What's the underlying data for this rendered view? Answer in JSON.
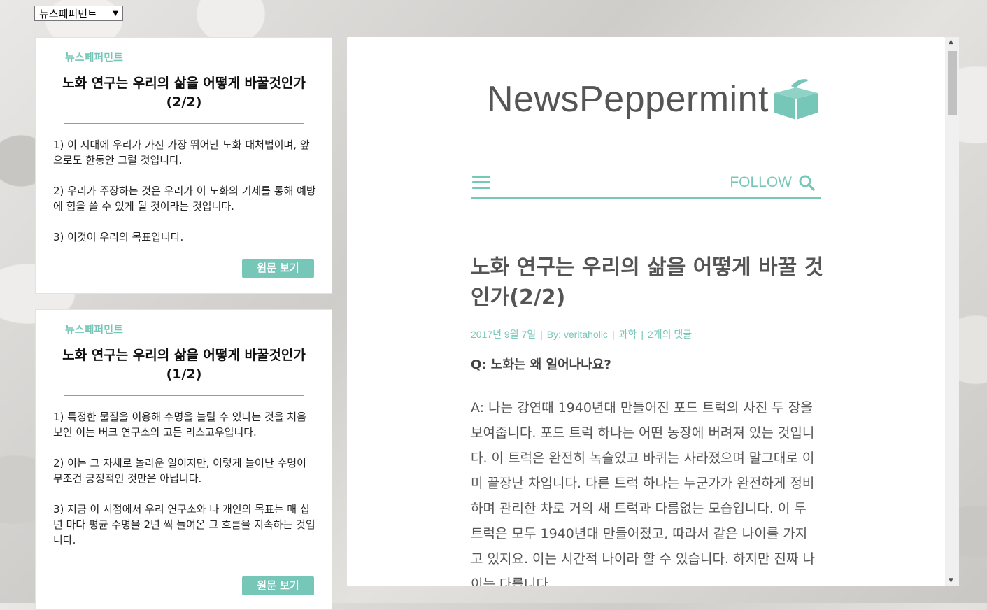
{
  "site_select": {
    "value": "뉴스페퍼민트"
  },
  "sidebar": {
    "cards": [
      {
        "source": "뉴스페퍼민트",
        "title": "노화 연구는 우리의 삶을 어떻게 바꿀것인가(2/2)",
        "points": [
          "1) 이 시대에 우리가 가진 가장 뛰어난 노화 대처법이며, 앞으로도 한동안 그럴 것입니다.",
          "2) 우리가 주장하는 것은 우리가 이 노화의 기제를 통해 예방에 힘을 쓸 수 있게 될 것이라는 것입니다.",
          "3) 이것이 우리의 목표입니다."
        ],
        "button": "원문 보기"
      },
      {
        "source": "뉴스페퍼민트",
        "title": "노화 연구는 우리의 삶을 어떻게 바꿀것인가(1/2)",
        "points": [
          "1) 특정한 물질을 이용해 수명을 늘릴 수 있다는 것을 처음 보인 이는 버크 연구소의 고든 리스고우입니다.",
          "2) 이는 그 자체로 놀라운 일이지만, 이렇게 늘어난 수명이 무조건 긍정적인 것만은 아닙니다.",
          "3) 지금 이 시점에서 우리 연구소와 나 개인의 목표는 매 십 년 마다 평균 수명을 2년 씩 늘여온 그 흐름을 지속하는 것입니다."
        ],
        "button": "원문 보기"
      }
    ]
  },
  "main": {
    "logo_text": "NewsPeppermint",
    "nav": {
      "follow": "FOLLOW"
    },
    "article": {
      "title": "노화 연구는 우리의 삶을 어떻게 바꿀 것인가(2/2)",
      "meta": {
        "date": "2017년 9월 7일",
        "author": "By: veritaholic",
        "category": "과학",
        "comments": "2개의 댓글"
      },
      "question": "Q: 노화는 왜 일어나나요?",
      "answer": "A: 나는 강연때 1940년대 만들어진 포드 트럭의 사진 두 장을 보여줍니다. 포드 트럭 하나는 어떤 농장에 버려져 있는 것입니다. 이 트럭은 완전히 녹슬었고 바퀴는 사라졌으며 말그대로 이미 끝장난 차입니다. 다른 트럭 하나는 누군가가 완전하게 정비하며 관리한 차로 거의 새 트럭과 다름없는 모습입니다. 이 두 트럭은 모두 1940년대 만들어졌고, 따라서 같은 나이를 가지고 있지요. 이는 시간적 나이라 할 수 있습니다. 하지만 진짜 나이는 다릅니다."
    }
  },
  "colors": {
    "accent": "#76c7b8",
    "text": "#555555"
  }
}
